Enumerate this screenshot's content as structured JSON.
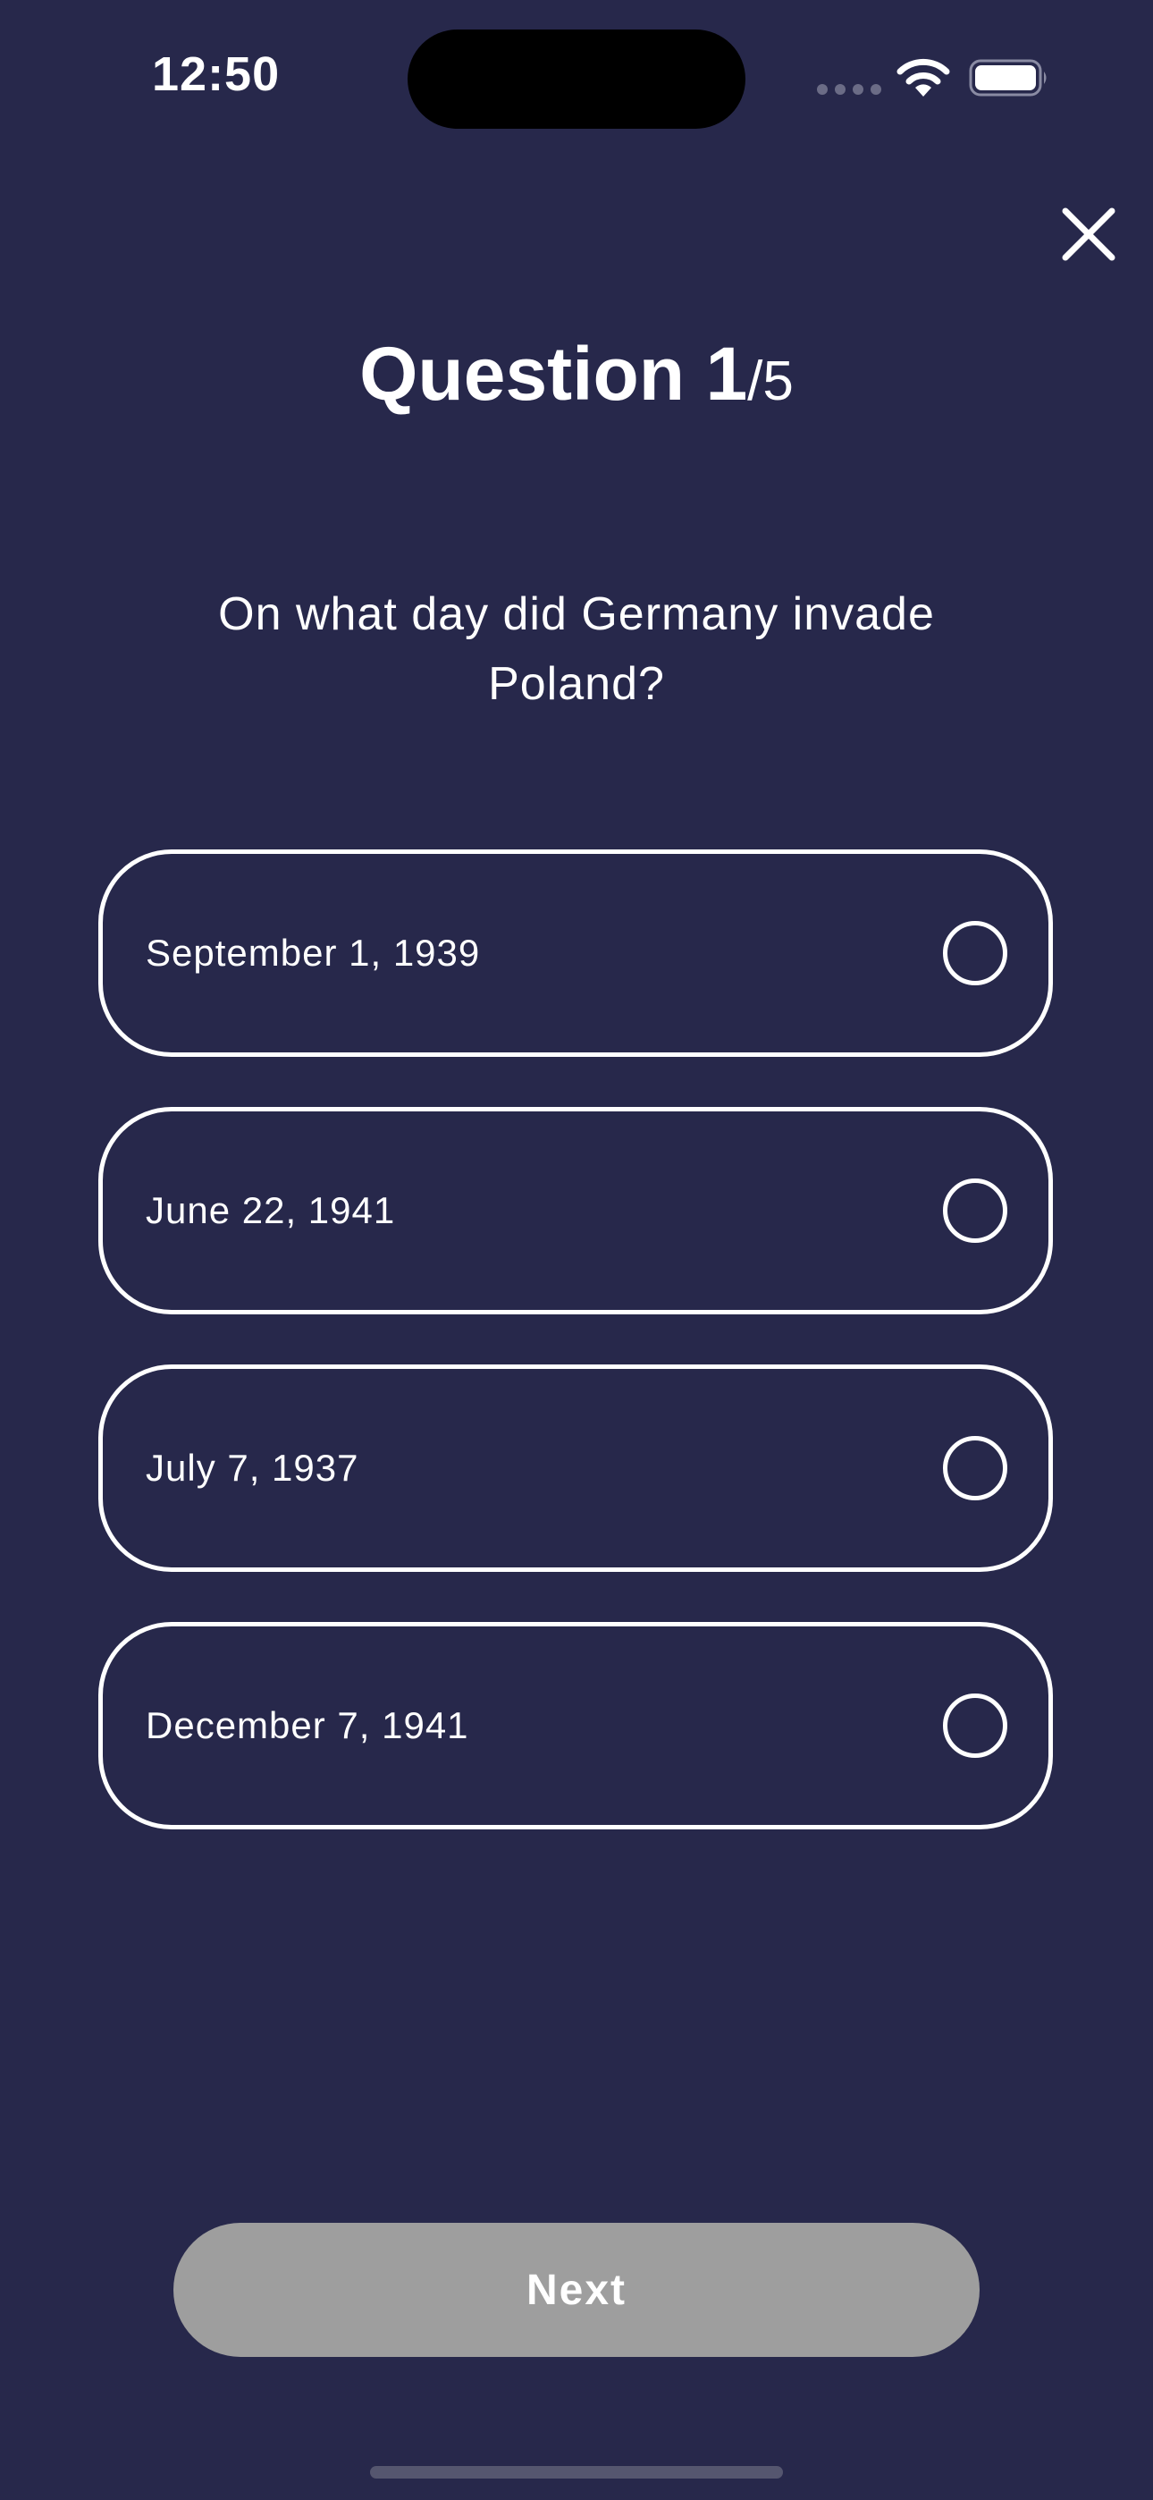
{
  "status_bar": {
    "time": "12:50",
    "icons": [
      "cellular-signal-icon",
      "wifi-icon",
      "battery-icon"
    ]
  },
  "header": {
    "close_icon": "close-icon",
    "title_main": "Question 1",
    "title_total": "/5"
  },
  "question": {
    "text": "On what day did Germany invade Poland?"
  },
  "options": [
    {
      "label": "September 1, 1939",
      "selected": false
    },
    {
      "label": "June 22, 1941",
      "selected": false
    },
    {
      "label": "July 7, 1937",
      "selected": false
    },
    {
      "label": "December 7, 1941",
      "selected": false
    }
  ],
  "footer": {
    "next_label": "Next",
    "next_enabled": false
  },
  "colors": {
    "background": "#27284b",
    "foreground": "#ffffff",
    "disabled_button": "#9e9e9e"
  }
}
